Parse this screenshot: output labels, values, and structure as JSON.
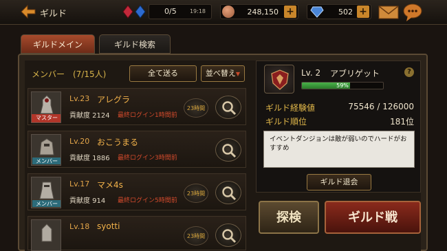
{
  "header": {
    "title": "ギルド",
    "stamina": {
      "value": "0/5",
      "timer": "19:18"
    },
    "gold": "248,150",
    "gems": "502",
    "plus": "+"
  },
  "tabs": [
    {
      "label": "ギルドメイン",
      "active": true
    },
    {
      "label": "ギルド検索",
      "active": false
    }
  ],
  "members": {
    "title": "メンバー　(7/15人)",
    "send_all": "全て送る",
    "sort": "並べ替え",
    "list": [
      {
        "level": "Lv.23",
        "name": "アレグラ",
        "role": "マスター",
        "contribution": "貢献度 2124",
        "last_login": "最終ログイン1時間前",
        "time_badge": "23時間"
      },
      {
        "level": "Lv.20",
        "name": "おこうまる",
        "role": "メンバー",
        "contribution": "貢献度 1886",
        "last_login": "最終ログイン3時間前",
        "time_badge": ""
      },
      {
        "level": "Lv.17",
        "name": "マメ4s",
        "role": "メンバー",
        "contribution": "貢献度 914",
        "last_login": "最終ログイン5時間前",
        "time_badge": "23時間"
      },
      {
        "level": "Lv.18",
        "name": "syotti",
        "role": "",
        "contribution": "",
        "last_login": "",
        "time_badge": "23時間"
      }
    ]
  },
  "guild": {
    "level": "Lv. 2",
    "name": "アブリゲット",
    "help": "?",
    "xp_percent_label": "59%",
    "xp_fraction": 0.59,
    "stats": [
      {
        "label": "ギルド経験値",
        "value": "75546 / 126000"
      },
      {
        "label": "ギルド順位",
        "value": "181位"
      }
    ],
    "description": "イベントダンジョンは敵が弱いのでハードがおすすめ",
    "leave_button": "ギルド退会"
  },
  "actions": {
    "explore": "探検",
    "guild_war": "ギルド戦"
  },
  "colors": {
    "accent_gold": "#e2b84a",
    "login_red": "#d24a2c",
    "master_red": "#b2362a",
    "member_teal": "#2c6b7a"
  }
}
